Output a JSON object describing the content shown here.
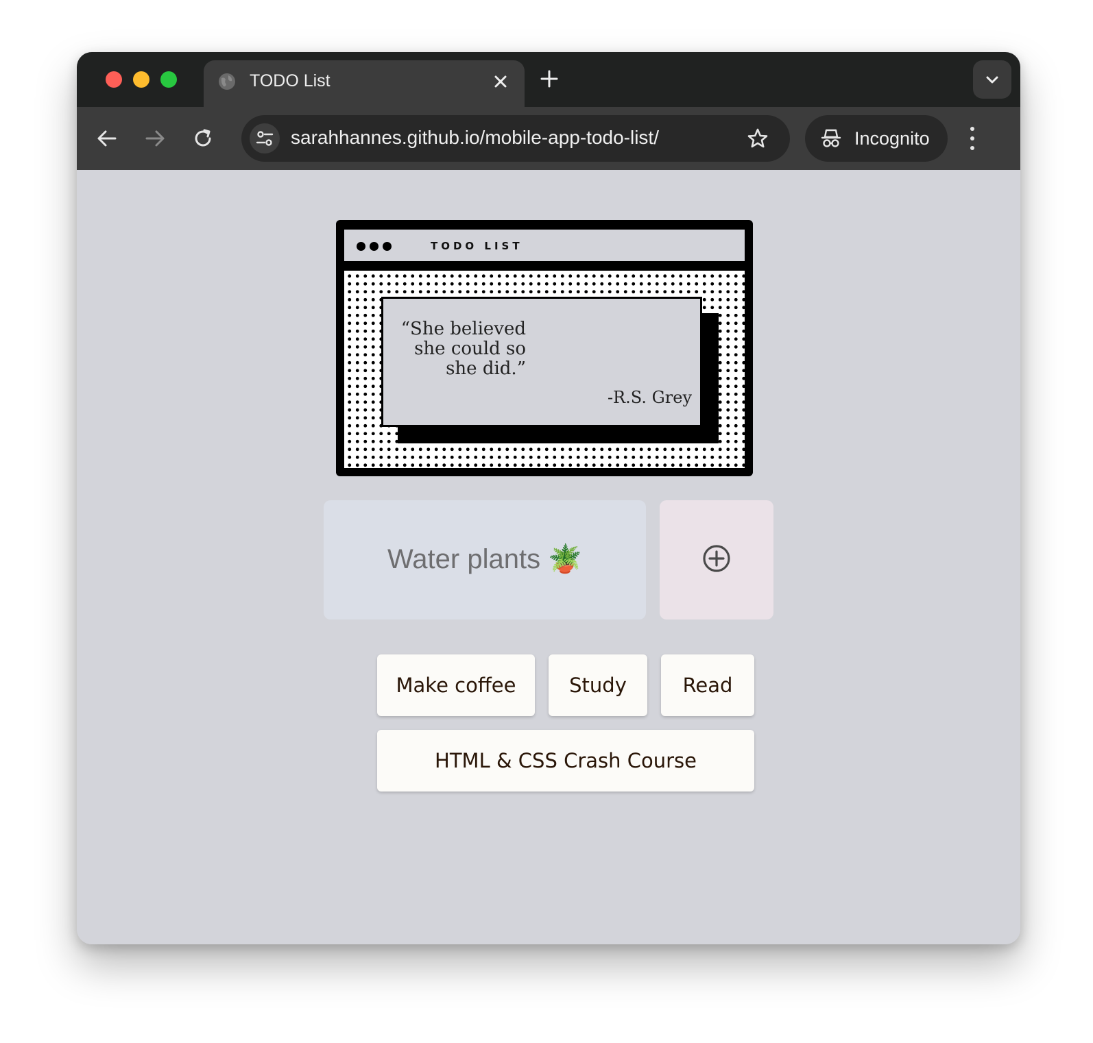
{
  "browser": {
    "tab_title": "TODO List",
    "url": "sarahhannes.github.io/mobile-app-todo-list/",
    "incognito_label": "Incognito"
  },
  "card": {
    "title": "TODO LIST",
    "quote": "“She believed she could so she did.”",
    "quote_lines": [
      "“She believed",
      "she could so",
      "she did.”"
    ],
    "author": "-R.S. Grey"
  },
  "task_input": {
    "value": "Water plants 🪴"
  },
  "tasks": [
    "Make coffee",
    "Study",
    "Read",
    "HTML & CSS Crash Course"
  ],
  "colors": {
    "page_bg": "#d3d4da",
    "input_bg": "#dadee7",
    "add_button_bg": "#ebe2e8",
    "chip_bg": "#fcfbf8",
    "chip_text": "#2a1608"
  },
  "icons": {
    "tab": "globe-icon",
    "add": "plus-circle-icon",
    "bookmark": "star-icon",
    "incognito": "incognito-icon"
  }
}
